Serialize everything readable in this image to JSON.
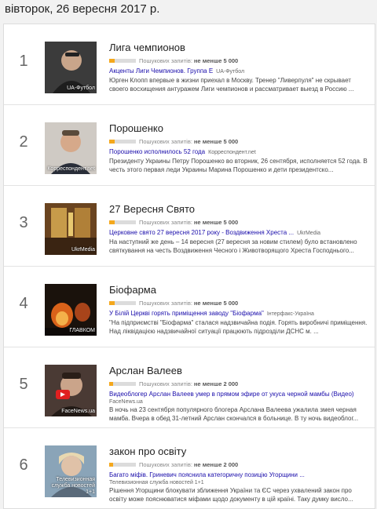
{
  "date": "вівторок, 26 вересня 2017 р.",
  "meta_label": "Пошукових запитів:",
  "trends": [
    {
      "rank": "1",
      "title": "Лига чемпионов",
      "volume": "не менше 5 000",
      "volume_level": 0.2,
      "headline": "Акценты Лиги Чемпионов. Группа Е",
      "publisher": "UA-Футбол",
      "pub_line": "",
      "snippet": "Юрген Клопп впервые в жизни приехал в Москву. Тренер \"Ливерпуля\" не скрывает своего восхищения антуражем Лиги чемпионов и рассматривает выезд в Россию ...",
      "thumb_source": "UA-Футбол",
      "thumb_color": "#4a3b30"
    },
    {
      "rank": "2",
      "title": "Порошенко",
      "volume": "не менше 5 000",
      "volume_level": 0.2,
      "headline": "Порошенко исполнилось 52 года",
      "publisher": "Корреспондент.net",
      "pub_line": "",
      "snippet": "Президенту Украины Петру Порошенко во вторник, 26 сентября, исполняется 52 года. В честь этого первая леди Украины Марина Порошенко и дети президентско...",
      "thumb_source": "Корреспондент.net",
      "thumb_color": "#7a6a5c"
    },
    {
      "rank": "3",
      "title": "27 Вересня Свято",
      "volume": "не менше 5 000",
      "volume_level": 0.2,
      "headline": "Церковне свято 27 вересня 2017 року - Воздвиження Хреста ...",
      "publisher": "UkrMedia",
      "pub_line": "",
      "snippet": "На наступний же день – 14 вересня (27 вересня за новим стилем) було встановлено святкування на честь Воздвиження Чесного і Животворящого Хреста Господнього...",
      "thumb_source": "UkrMedia",
      "thumb_color": "#8a5a2a"
    },
    {
      "rank": "4",
      "title": "Біофарма",
      "volume": "не менше 5 000",
      "volume_level": 0.2,
      "headline": "У Білій Церкві горять приміщення заводу \"Біофарма\"",
      "publisher": "Інтерфакс-Україна",
      "pub_line": "",
      "snippet": "\"На підприємстві \"Біофарма\" сталася надзвичайна подія. Горять виробничі приміщення. Над ліквідацією надзвичайної ситуації працюють підрозділи ДСНС м. ...",
      "thumb_source": "ГЛАВКОМ",
      "thumb_color": "#2a1a12"
    },
    {
      "rank": "5",
      "title": "Арслан Валеев",
      "volume": "не менше 2 000",
      "volume_level": 0.15,
      "headline": "Видеоблогер Арслан Валеев умер в прямом эфире от укуса черной мамбы (Видео)",
      "publisher": "",
      "pub_line": "FaceNews.ua",
      "snippet": "В ночь на 23 сентября популярного блогера Арслана Валеева ужалила змея черная мамба. Вчера в обед 31-летний Арслан скончался в больнице. В ту ночь видеоблог...",
      "thumb_source": "FaceNews.ua",
      "thumb_color": "#5a4a44"
    },
    {
      "rank": "6",
      "title": "закон про освіту",
      "volume": "не менше 2 000",
      "volume_level": 0.15,
      "headline": "Багато міфів. Гриневич пояснила категоричну позицію Угорщини ...",
      "publisher": "",
      "pub_line": "Телевизионная служба новостей 1+1",
      "snippet": "Рішення Угорщини блокувати зближення України та ЄС через ухвалений закон про освіту може пояснюватися міфами щодо документу в цій країні. Таку думку висло...",
      "thumb_source": "Телевизионная служба новостей 1+1",
      "thumb_color": "#b8a88a"
    }
  ]
}
